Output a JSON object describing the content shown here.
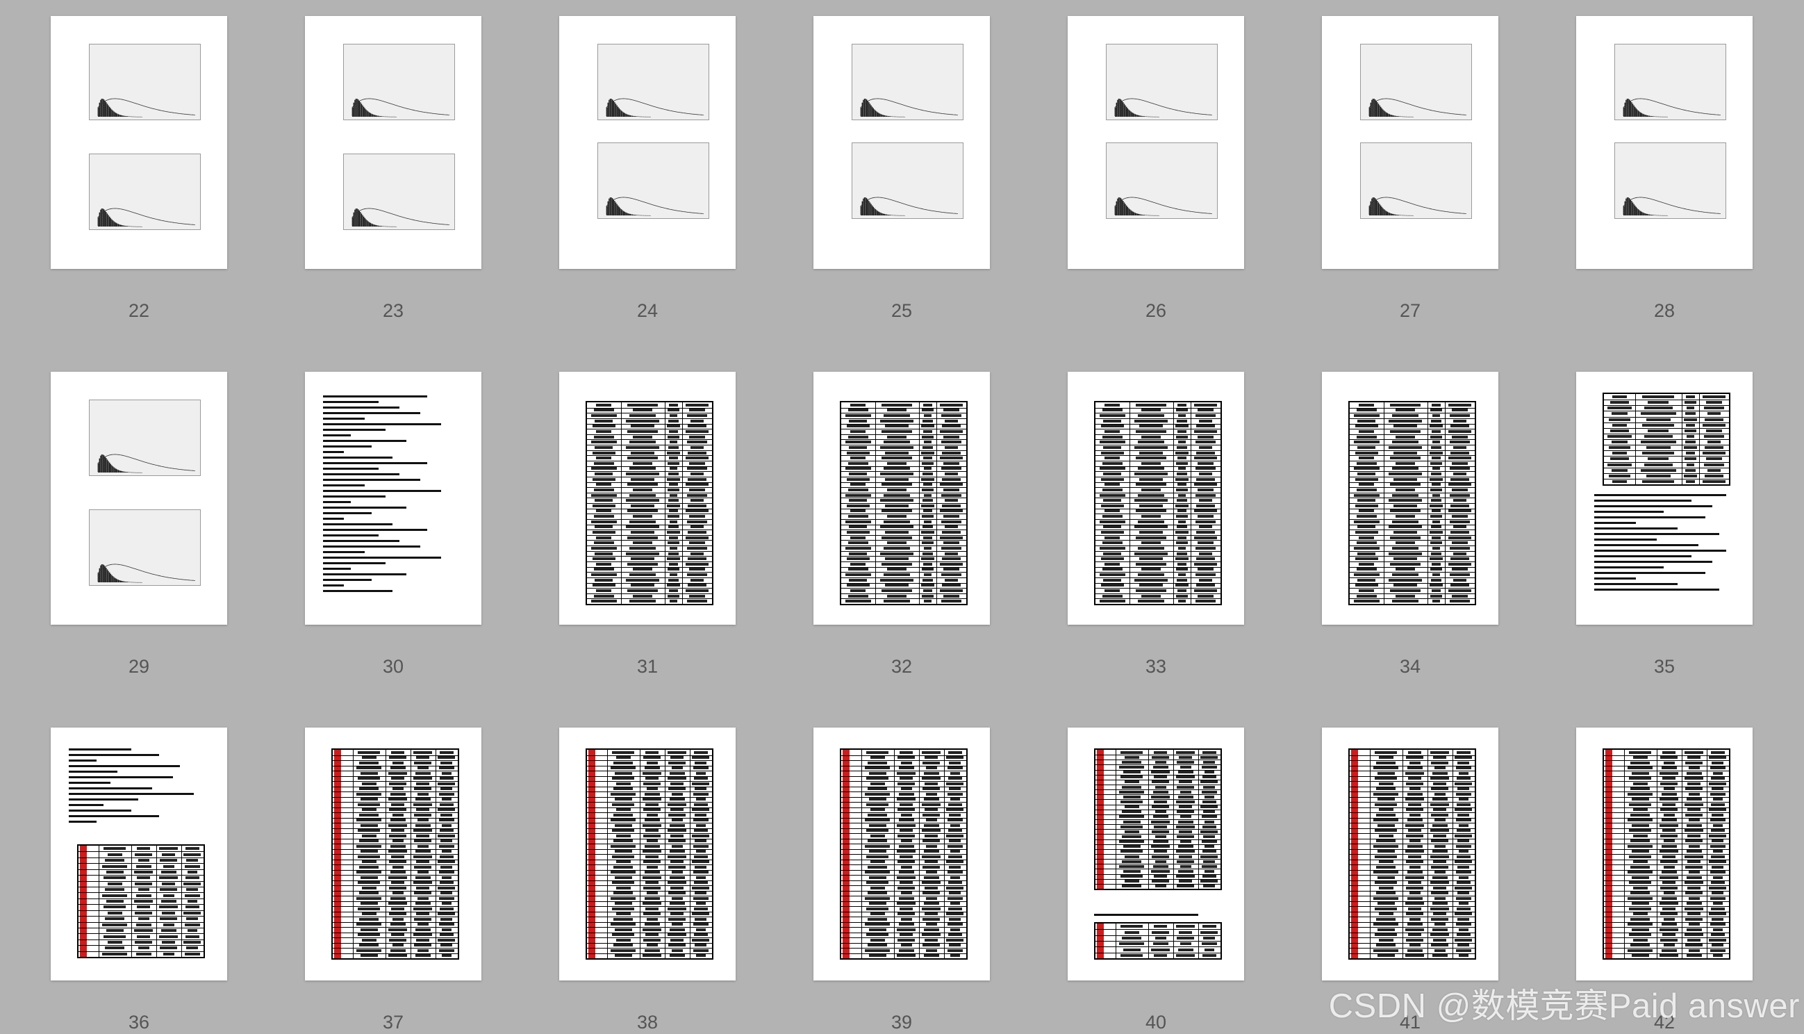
{
  "pages": [
    {
      "number": "22",
      "type": "chart"
    },
    {
      "number": "23",
      "type": "chart"
    },
    {
      "number": "24",
      "type": "chart"
    },
    {
      "number": "25",
      "type": "chart"
    },
    {
      "number": "26",
      "type": "chart"
    },
    {
      "number": "27",
      "type": "chart"
    },
    {
      "number": "28",
      "type": "chart"
    },
    {
      "number": "29",
      "type": "chart"
    },
    {
      "number": "30",
      "type": "code"
    },
    {
      "number": "31",
      "type": "table"
    },
    {
      "number": "32",
      "type": "table"
    },
    {
      "number": "33",
      "type": "table"
    },
    {
      "number": "34",
      "type": "table"
    },
    {
      "number": "35",
      "type": "table-text"
    },
    {
      "number": "36",
      "type": "code-redtable"
    },
    {
      "number": "37",
      "type": "redtable"
    },
    {
      "number": "38",
      "type": "redtable"
    },
    {
      "number": "39",
      "type": "redtable"
    },
    {
      "number": "40",
      "type": "redtable-short"
    },
    {
      "number": "41",
      "type": "redtable"
    },
    {
      "number": "42",
      "type": "redtable"
    }
  ],
  "watermark": "CSDN @数模竞赛Paid answer",
  "colors": {
    "background": "#b3b3b3",
    "page": "#ffffff",
    "highlight": "#d21a1a"
  }
}
